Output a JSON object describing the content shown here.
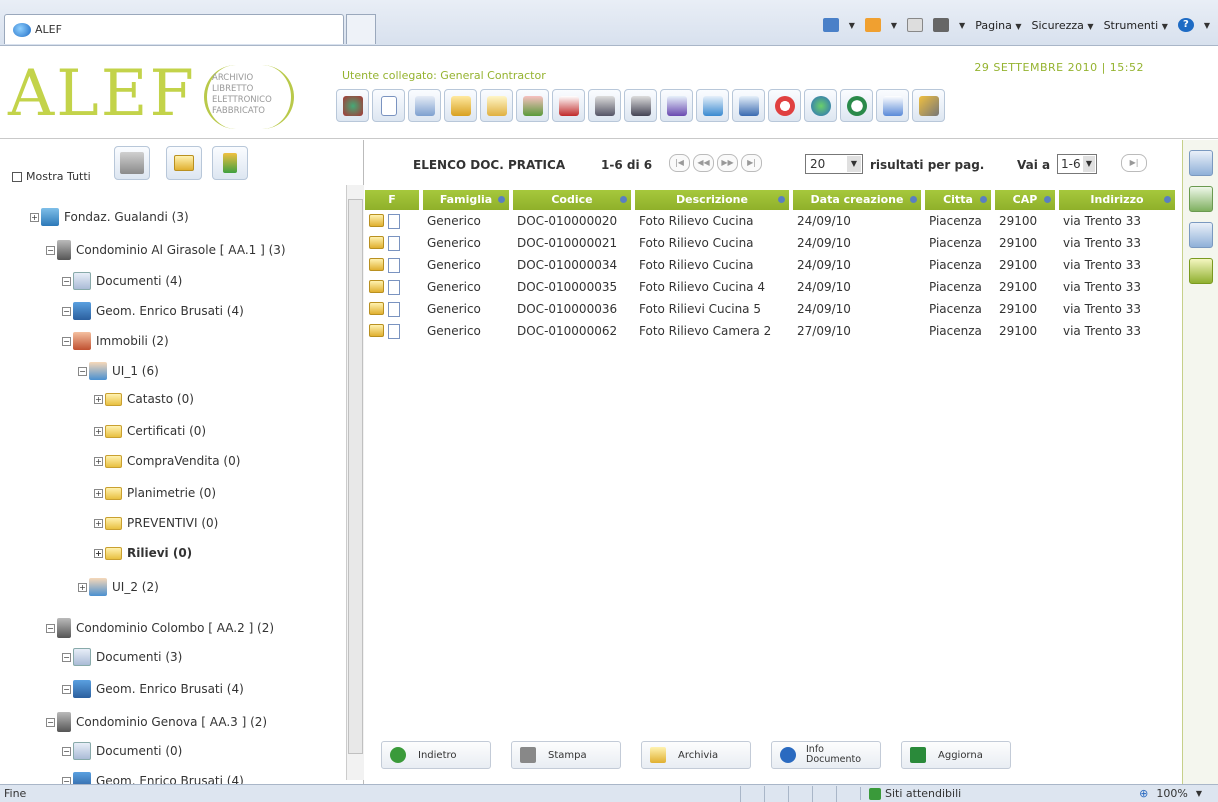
{
  "browser": {
    "tab_title": "ALEF",
    "cmd_pagina": "Pagina",
    "cmd_sicurezza": "Sicurezza",
    "cmd_strumenti": "Strumenti",
    "status_text": "Fine",
    "status_zone": "Siti attendibili",
    "zoom": "100%"
  },
  "header": {
    "logo_text": "ALEF",
    "logo_sub": [
      "ARCHIVIO",
      "LIBRETTO",
      "ELETTRONICO",
      "FABBRICATO"
    ],
    "user_label": "Utente collegato: General Contractor",
    "date_label": "29 SETTEMBRE 2010 | 15:52"
  },
  "sidebar": {
    "mostra_tutti": "Mostra Tutti",
    "tree": [
      {
        "label": "Fondaz. Gualandi (3)",
        "expander": "⊞"
      },
      {
        "label": "Condominio Al Girasole [ AA.1 ] (3)",
        "expander": "⊟"
      },
      {
        "label": "Documenti (4)",
        "expander": "⊟"
      },
      {
        "label": "Geom. Enrico Brusati (4)",
        "expander": "⊟"
      },
      {
        "label": "Immobili (2)",
        "expander": "⊟"
      },
      {
        "label": "UI_1 (6)",
        "expander": "⊟"
      },
      {
        "label": "Catasto (0)",
        "expander": "⊞"
      },
      {
        "label": "Certificati (0)",
        "expander": "⊞"
      },
      {
        "label": "CompraVendita (0)",
        "expander": "⊞"
      },
      {
        "label": "Planimetrie (0)",
        "expander": "⊞"
      },
      {
        "label": "PREVENTIVI (0)",
        "expander": "⊞"
      },
      {
        "label": "Rilievi (0)",
        "expander": "⊞"
      },
      {
        "label": "UI_2 (2)",
        "expander": "⊞"
      },
      {
        "label": "Condominio Colombo [ AA.2 ] (2)",
        "expander": "⊟"
      },
      {
        "label": "Documenti (3)",
        "expander": "⊟"
      },
      {
        "label": "Geom. Enrico Brusati (4)",
        "expander": "⊟"
      },
      {
        "label": "Condominio Genova [ AA.3 ] (2)",
        "expander": "⊟"
      },
      {
        "label": "Documenti (0)",
        "expander": "⊟"
      },
      {
        "label": "Geom. Enrico Brusati (4)",
        "expander": "⊟"
      }
    ]
  },
  "list": {
    "title": "ELENCO DOC. PRATICA",
    "count": "1-6 di 6",
    "per_page_value": "20",
    "per_page_label": "risultati per pag.",
    "goto_label": "Vai a",
    "goto_value": "1-6",
    "columns": [
      "F",
      "Famiglia",
      "Codice",
      "Descrizione",
      "Data creazione",
      "Citta",
      "CAP",
      "Indirizzo"
    ],
    "rows": [
      [
        "Generico",
        "DOC-010000020",
        "Foto Rilievo Cucina",
        "24/09/10",
        "Piacenza",
        "29100",
        "via Trento 33"
      ],
      [
        "Generico",
        "DOC-010000021",
        "Foto Rilievo Cucina",
        "24/09/10",
        "Piacenza",
        "29100",
        "via Trento 33"
      ],
      [
        "Generico",
        "DOC-010000034",
        "Foto Rilievo Cucina",
        "24/09/10",
        "Piacenza",
        "29100",
        "via Trento 33"
      ],
      [
        "Generico",
        "DOC-010000035",
        "Foto Rilievo Cucina 4",
        "24/09/10",
        "Piacenza",
        "29100",
        "via Trento 33"
      ],
      [
        "Generico",
        "DOC-010000036",
        "Foto Rilievi Cucina 5",
        "24/09/10",
        "Piacenza",
        "29100",
        "via Trento 33"
      ],
      [
        "Generico",
        "DOC-010000062",
        "Foto Rilievo Camera 2",
        "27/09/10",
        "Piacenza",
        "29100",
        "via Trento 33"
      ]
    ]
  },
  "actions": {
    "indietro": "Indietro",
    "stampa": "Stampa",
    "archivia": "Archivia",
    "info_1": "Info",
    "info_2": "Documento",
    "aggiorna": "Aggiorna"
  },
  "colors": {
    "accent_green": "#95b330",
    "header_green": "#9cbc34"
  }
}
